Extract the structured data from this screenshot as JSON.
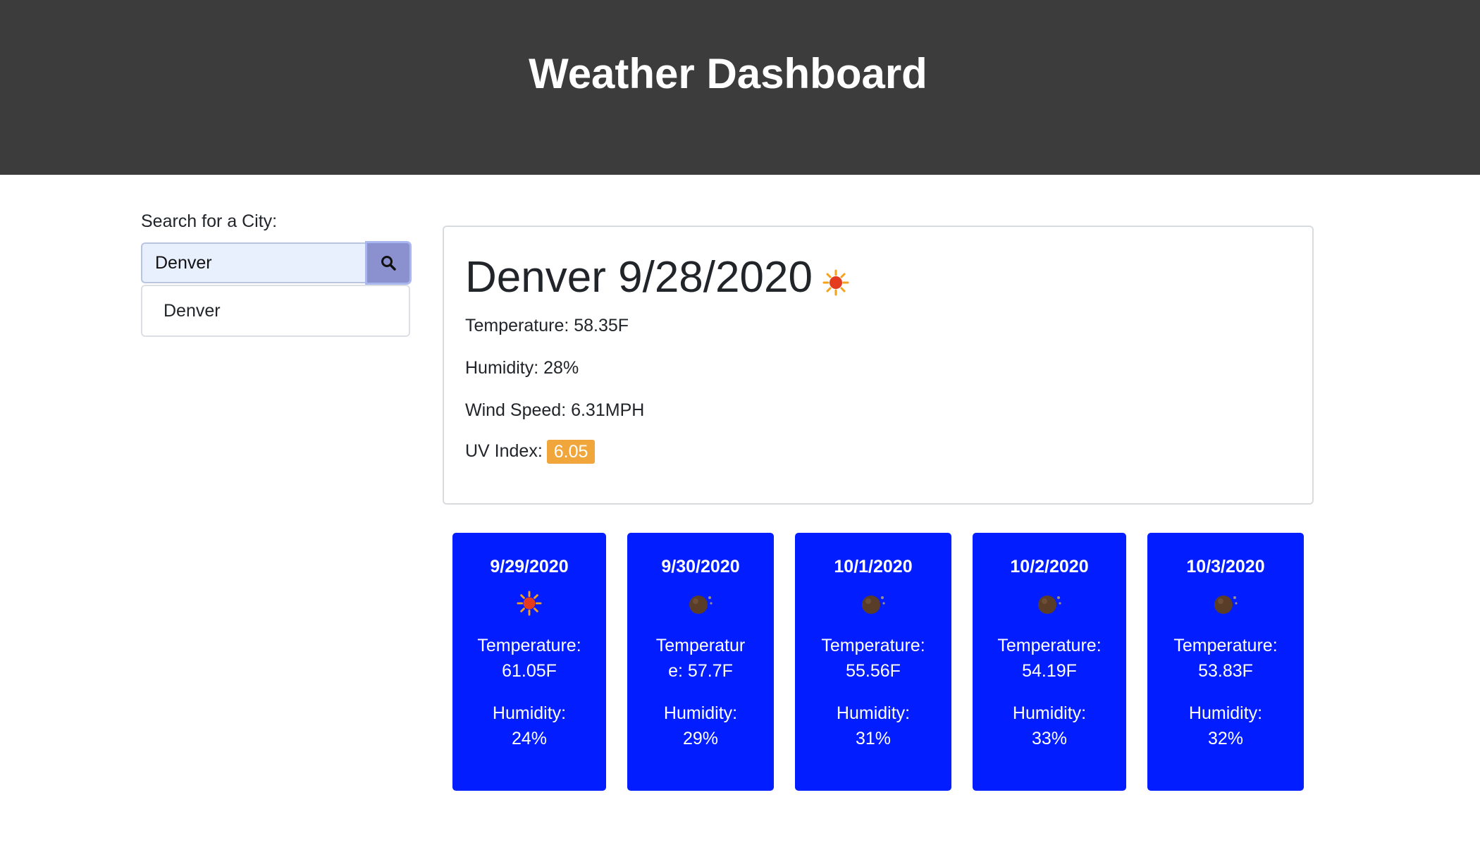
{
  "header": {
    "title": "Weather Dashboard"
  },
  "search": {
    "label": "Search for a City:",
    "value": "Denver",
    "placeholder": "",
    "button_icon": "search-icon",
    "history": [
      "Denver"
    ]
  },
  "current": {
    "city": "Denver",
    "date": "9/28/2020",
    "icon": "sun-icon",
    "temperature": "Temperature: 58.35F",
    "humidity": "Humidity: 28%",
    "wind": "Wind Speed: 6.31MPH",
    "uv_label": "UV Index:",
    "uv_value": "6.05",
    "uv_color": "#f0a63a"
  },
  "forecast": [
    {
      "date": "9/29/2020",
      "icon": "sun-icon",
      "temp_label": "Temperature:",
      "temp_value": "61.05F",
      "humidity_label": "Humidity:",
      "humidity_value": "24%"
    },
    {
      "date": "9/30/2020",
      "icon": "moon-icon",
      "temp_label": "Temperatur",
      "temp_value": "e: 57.7F",
      "humidity_label": "Humidity:",
      "humidity_value": "29%"
    },
    {
      "date": "10/1/2020",
      "icon": "moon-icon",
      "temp_label": "Temperature:",
      "temp_value": "55.56F",
      "humidity_label": "Humidity:",
      "humidity_value": "31%"
    },
    {
      "date": "10/2/2020",
      "icon": "moon-icon",
      "temp_label": "Temperature:",
      "temp_value": "54.19F",
      "humidity_label": "Humidity:",
      "humidity_value": "33%"
    },
    {
      "date": "10/3/2020",
      "icon": "moon-icon",
      "temp_label": "Temperature:",
      "temp_value": "53.83F",
      "humidity_label": "Humidity:",
      "humidity_value": "32%"
    }
  ],
  "colors": {
    "header_bg": "#3c3c3c",
    "card_bg": "#021dff",
    "search_button": "#8b91cf",
    "input_bg": "#e8f0fe"
  }
}
